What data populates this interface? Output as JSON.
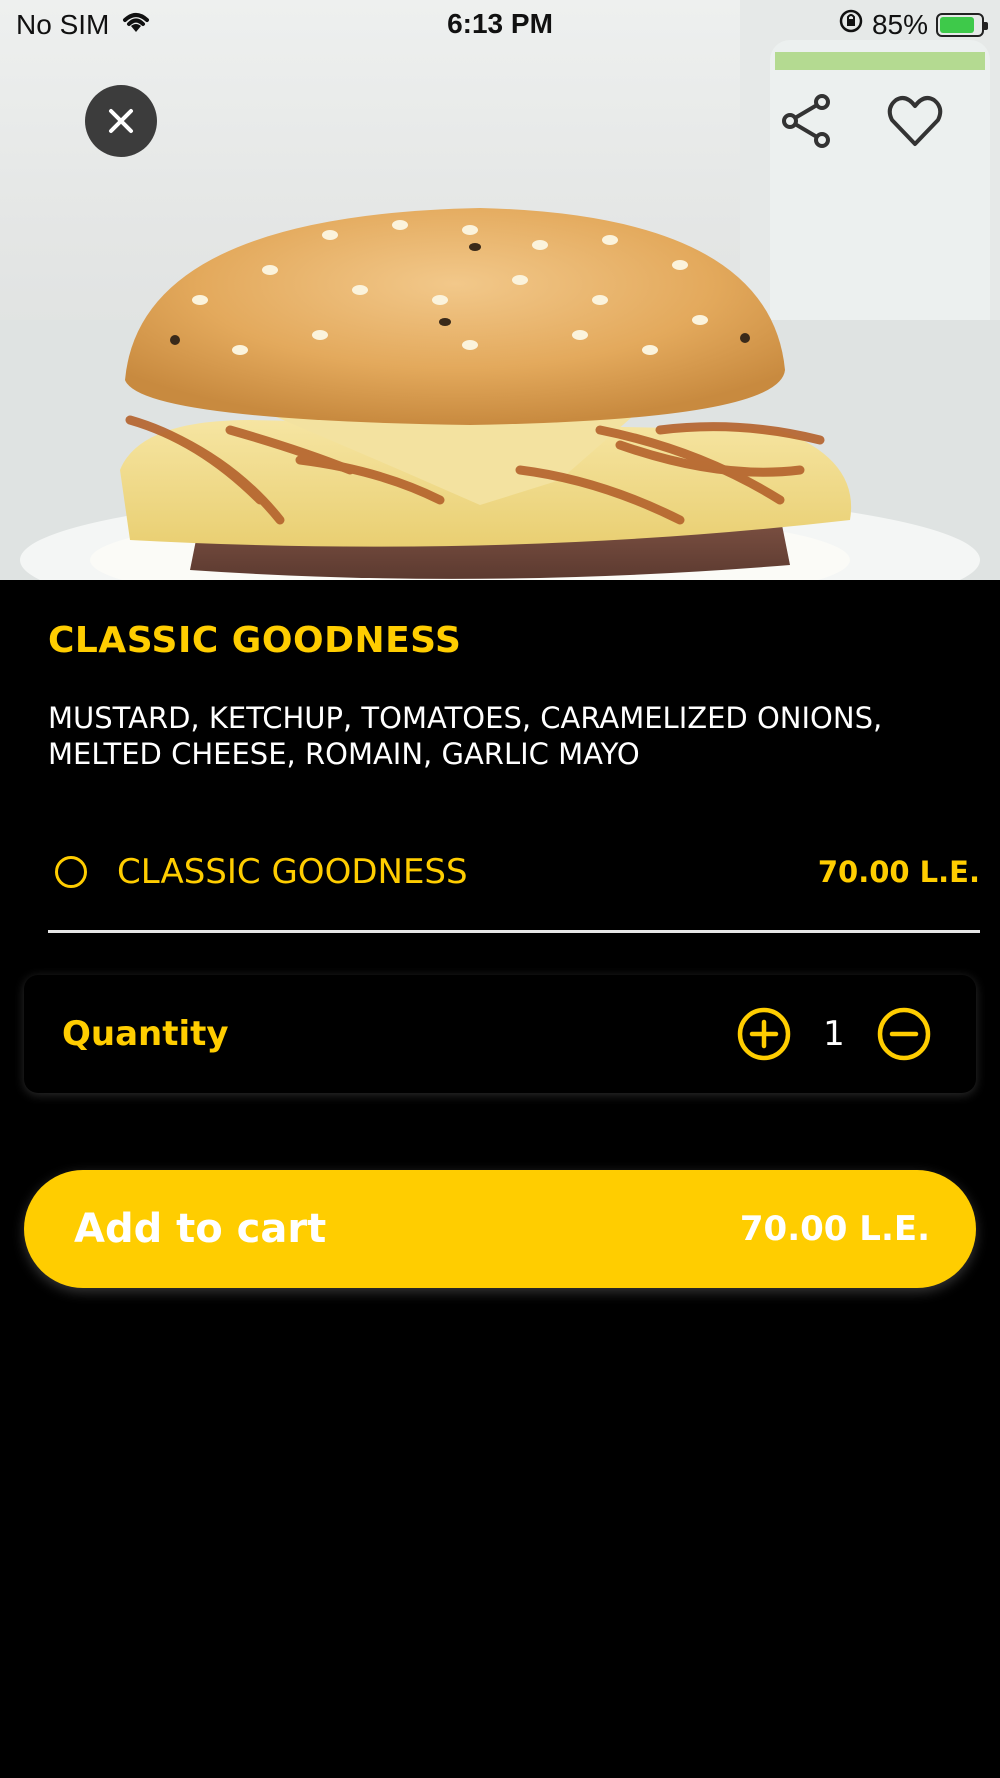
{
  "status_bar": {
    "carrier": "No SIM",
    "time": "6:13 PM",
    "battery_percent": "85%",
    "battery_level": 0.85,
    "icons": [
      "wifi-icon",
      "orientation-lock-icon",
      "battery-charging-icon"
    ]
  },
  "hero": {
    "image": "burger-photo",
    "buttons": {
      "close": "close-icon",
      "share": "share-icon",
      "favorite": "heart-icon"
    }
  },
  "product": {
    "title": "CLASSIC GOODNESS",
    "description_line1": "MUSTARD, KETCHUP, TOMATOES, CARAMELIZED ONIONS,",
    "description_line2": "MELTED CHEESE, ROMAIN, GARLIC MAYO"
  },
  "option": {
    "label": "CLASSIC GOODNESS",
    "price": "70.00 L.E.",
    "selected": false
  },
  "quantity": {
    "label": "Quantity",
    "value": "1"
  },
  "cart": {
    "label": "Add to cart",
    "price": "70.00 L.E."
  },
  "colors": {
    "accent": "#ffcd00",
    "background": "#000000",
    "text": "#ffffff"
  }
}
